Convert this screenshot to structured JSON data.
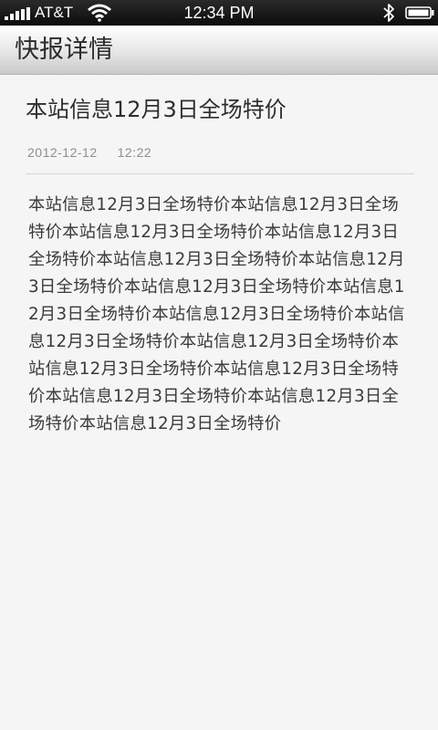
{
  "status_bar": {
    "carrier": "AT&T",
    "time": "12:34 PM",
    "icons": [
      "signal-icon",
      "wifi-icon",
      "bluetooth-icon",
      "battery-icon"
    ]
  },
  "title_bar": {
    "title": "快报详情"
  },
  "article": {
    "headline": "本站信息12月3日全场特价",
    "date": "2012-12-12",
    "time": "12:22",
    "body": "本站信息12月3日全场特价本站信息12月3日全场特价本站信息12月3日全场特价本站信息12月3日全场特价本站信息12月3日全场特价本站信息12月3日全场特价本站信息12月3日全场特价本站信息12月3日全场特价本站信息12月3日全场特价本站信息12月3日全场特价本站信息12月3日全场特价本站信息12月3日全场特价本站信息12月3日全场特价本站信息12月3日全场特价本站信息12月3日全场特价本站信息12月3日全场特价"
  }
}
